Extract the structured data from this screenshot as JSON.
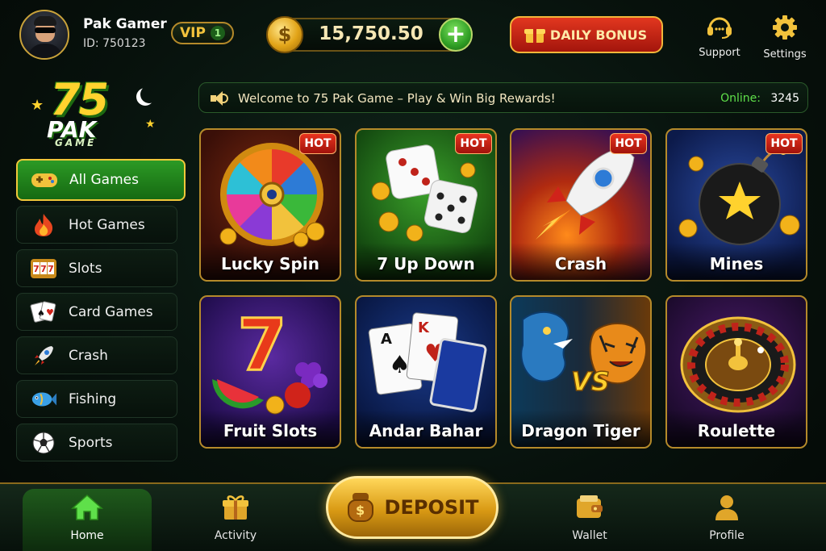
{
  "player": {
    "name": "Pak Gamer",
    "id_text": "ID: 750123",
    "vip_label": "VIP",
    "vip_level": "1"
  },
  "wallet": {
    "balance": "15,750.50",
    "currency_icon": "dollar-coin-icon",
    "add_icon": "plus-icon"
  },
  "daily_bonus": {
    "label": "DAILY BONUS",
    "icon": "gift-icon"
  },
  "top_actions": [
    {
      "label": "Support",
      "icon": "headset-icon"
    },
    {
      "label": "Settings",
      "icon": "gear-icon"
    }
  ],
  "logo": {
    "number": "75",
    "word": "PAK",
    "sub": "GAME"
  },
  "announcement": {
    "text": "Welcome to 75 Pak Game – Play & Win Big Rewards!",
    "online_label": "Online:",
    "online_count": "3245"
  },
  "sidebar": {
    "items": [
      {
        "label": "All Games",
        "icon": "gamepad-icon",
        "active": true
      },
      {
        "label": "Hot Games",
        "icon": "flame-icon",
        "active": false
      },
      {
        "label": "Slots",
        "icon": "slot-machine-icon",
        "active": false
      },
      {
        "label": "Card Games",
        "icon": "playing-cards-icon",
        "active": false
      },
      {
        "label": "Crash",
        "icon": "rocket-icon",
        "active": false
      },
      {
        "label": "Fishing",
        "icon": "fish-icon",
        "active": false
      },
      {
        "label": "Sports",
        "icon": "soccer-ball-icon",
        "active": false
      }
    ]
  },
  "games": [
    {
      "title": "Lucky Spin",
      "badge": "HOT"
    },
    {
      "title": "7 Up Down",
      "badge": "HOT"
    },
    {
      "title": "Crash",
      "badge": "HOT"
    },
    {
      "title": "Mines",
      "badge": "HOT"
    },
    {
      "title": "Fruit Slots",
      "badge": ""
    },
    {
      "title": "Andar Bahar",
      "badge": ""
    },
    {
      "title": "Dragon Tiger",
      "badge": "",
      "vs_text": "VS"
    },
    {
      "title": "Roulette",
      "badge": ""
    }
  ],
  "bottom_nav": {
    "items": [
      {
        "label": "Home",
        "icon": "home-icon",
        "active": true
      },
      {
        "label": "Activity",
        "icon": "gift-icon",
        "active": false
      },
      {
        "label": "Wallet",
        "icon": "wallet-icon",
        "active": false
      },
      {
        "label": "Profile",
        "icon": "user-icon",
        "active": false
      }
    ],
    "deposit_label": "DEPOSIT",
    "deposit_icon": "money-bag-icon",
    "deposit_bag_symbol": "$"
  },
  "colors": {
    "accent_gold": "#f2c23c",
    "accent_green": "#2c9a25",
    "hot_red": "#e8331f",
    "background": "#07110c"
  }
}
